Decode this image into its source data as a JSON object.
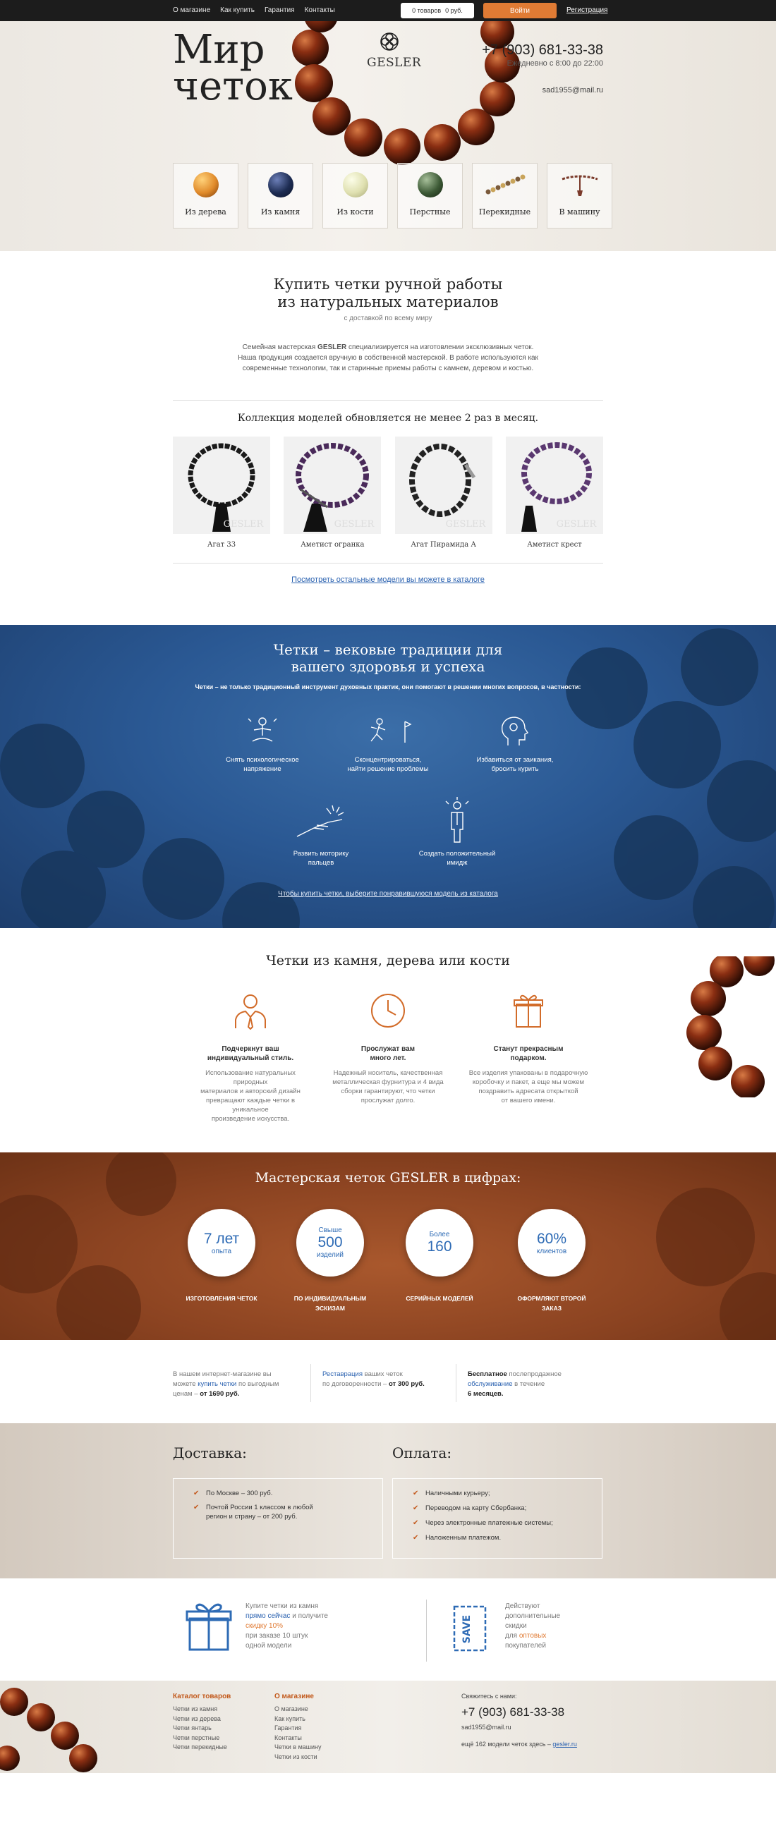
{
  "topbar": {
    "nav": [
      "О магазине",
      "Как купить",
      "Гарантия",
      "Контакты"
    ],
    "cart_items": "0 товаров",
    "cart_sum": "0 руб.",
    "login": "Войти",
    "register": "Регистрация"
  },
  "header": {
    "title_line1": "Мир",
    "title_line2": "четок",
    "logo": "GESLER",
    "phone": "+7 (903) 681-33-38",
    "hours": "Ежедневно с 8:00 до 22:00",
    "email": "sad1955@mail.ru"
  },
  "categories": [
    {
      "label": "Из дерева",
      "color": "#e08a2a"
    },
    {
      "label": "Из камня",
      "color": "#1d2c52"
    },
    {
      "label": "Из кости",
      "color": "#dfe0b0"
    },
    {
      "label": "Перстные",
      "color": "#3d5a36"
    },
    {
      "label": "Перекидные",
      "color": "#7a5a3a"
    },
    {
      "label": "В машину",
      "color": "#7a3a2a"
    }
  ],
  "intro": {
    "title_line1": "Купить четки ручной работы",
    "title_line2": "из натуральных материалов",
    "subtitle": "с доставкой по всему миру",
    "desc_1a": "Семейная мастерская ",
    "desc_brand": "GESLER",
    "desc_1b": " специализируется на изготовлении эксклюзивных четок.",
    "desc_2": "Наша продукция создается вручную в собственной мастерской. В работе используются как",
    "desc_3": "современные технологии, так и старинные приемы работы с камнем, деревом и костью.",
    "collection": "Коллекция моделей обновляется не менее 2 раз в месяц.",
    "catalog_link": "Посмотреть остальные модели вы можете в каталоге"
  },
  "products": [
    {
      "name": "Агат 33",
      "bead": "#1a1a1a"
    },
    {
      "name": "Аметист огранка",
      "bead": "#4a2a5a"
    },
    {
      "name": "Агат Пирамида А",
      "bead": "#222222"
    },
    {
      "name": "Аметист крест",
      "bead": "#5a3870"
    }
  ],
  "watermark": "GESLER",
  "blue": {
    "title_line1": "Четки – вековые традиции для",
    "title_line2": "вашего здоровья и успеха",
    "lead": "Четки – не только традиционный инструмент духовных практик, они помогают в решении многих вопросов, в частности:",
    "benefits": [
      {
        "l1": "Снять психологическое",
        "l2": "напряжение"
      },
      {
        "l1": "Сконцентрироваться,",
        "l2": "найти решение проблемы"
      },
      {
        "l1": "Избавиться от заикания,",
        "l2": "бросить курить"
      },
      {
        "l1": "Развить моторику",
        "l2": "пальцев"
      },
      {
        "l1": "Создать положительный",
        "l2": "имидж"
      }
    ],
    "link": "Чтобы купить четки, выберите понравившуюся модель из каталога"
  },
  "features": {
    "title": "Четки из камня, дерева или кости",
    "items": [
      {
        "t1": "Подчеркнут ваш",
        "t2": "индивидуальный стиль.",
        "d": [
          "Использование натуральных природных",
          "материалов и авторский дизайн",
          "превращают каждые четки в уникальное",
          "произведение искусства."
        ]
      },
      {
        "t1": "Прослужат вам",
        "t2": "много лет.",
        "d": [
          "Надежный носитель, качественная",
          "металлическая фурнитура и 4 вида",
          "сборки гарантируют, что четки",
          "прослужат долго."
        ]
      },
      {
        "t1": "Станут прекрасным",
        "t2": "подарком.",
        "d": [
          "Все изделия упакованы в подарочную",
          "коробочку и пакет, а еще мы можем",
          "поздравить адресата открыткой",
          "от вашего имени."
        ]
      }
    ]
  },
  "numbers": {
    "title": "Мастерская четок GESLER в цифрах:",
    "items": [
      {
        "top": "",
        "big": "7 лет",
        "bottom": "опыта",
        "cap1": "ИЗГОТОВЛЕНИЯ ЧЕТОК",
        "cap2": ""
      },
      {
        "top": "Свыше",
        "big": "500",
        "bottom": "изделий",
        "cap1": "ПО ИНДИВИДУАЛЬНЫМ",
        "cap2": "ЭСКИЗАМ"
      },
      {
        "top": "Более",
        "big": "160",
        "bottom": "",
        "cap1": "СЕРИЙНЫХ МОДЕЛЕЙ",
        "cap2": ""
      },
      {
        "top": "",
        "big": "60%",
        "bottom": "клиентов",
        "cap1": "ОФОРМЛЯЮТ ВТОРОЙ",
        "cap2": "ЗАКАЗ"
      }
    ]
  },
  "info": {
    "c1_l1": "В нашем интернет-магазине вы",
    "c1_l2a": "можете ",
    "c1_l2b": "купить четки",
    "c1_l2c": " по выгодным",
    "c1_l3a": "ценам – ",
    "c1_l3b": "от 1690 руб.",
    "c2_l1a": "Реставрация",
    "c2_l1b": " ваших четок",
    "c2_l2a": "по договоренности – ",
    "c2_l2b": "от 300 руб.",
    "c3_l1a": "Бесплатное",
    "c3_l1b": " послепродажное",
    "c3_l2a": "обслуживание",
    "c3_l2b": " в течение",
    "c3_l3": "6 месяцев."
  },
  "delivery": {
    "title": "Доставка:",
    "items": [
      "По Москве – 300 руб.",
      "Почтой России 1 классом в любой регион и страну – от 200 руб."
    ]
  },
  "payment": {
    "title": "Оплата:",
    "items": [
      "Наличными курьеру;",
      "Переводом на карту Сбербанка;",
      "Через электронные платежные системы;",
      "Наложенным платежом."
    ]
  },
  "promo": {
    "p1_l1": "Купите четки из камня",
    "p1_l2a": "прямо сейчас",
    "p1_l2b": " и получите",
    "p1_l3": "скидку 10%",
    "p1_l4": "при заказе 10 штук",
    "p1_l5": "одной модели",
    "save_label": "SAVE",
    "p2_l1": "Действуют",
    "p2_l2": "дополнительные",
    "p2_l3": "скидки",
    "p2_l4a": "для ",
    "p2_l4b": "оптовых",
    "p2_l5": "покупателей"
  },
  "footer": {
    "catalog_title": "Каталог товаров",
    "catalog": [
      "Четки из камня",
      "Четки из дерева",
      "Четки янтарь",
      "Четки перстные",
      "Четки перекидные"
    ],
    "about_title": "О магазине",
    "about": [
      "О магазине",
      "Как купить",
      "Гарантия",
      "Контакты",
      "Четки в машину",
      "Четки из кости"
    ],
    "contact_label": "Свяжитесь с нами:",
    "phone": "+7 (903) 681-33-38",
    "email": "sad1955@mail.ru",
    "more_a": "ещё 162 модели четок здесь – ",
    "more_link": "gesler.ru"
  }
}
